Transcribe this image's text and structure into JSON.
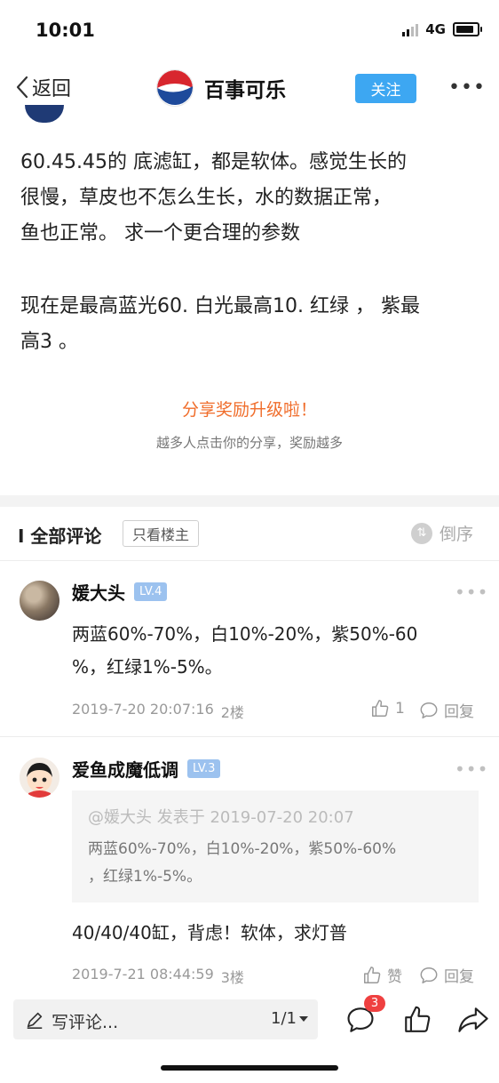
{
  "status_bar": {
    "time": "10:01",
    "network": "4G"
  },
  "nav": {
    "back_label": "返回",
    "title": "百事可乐",
    "follow_label": "关注",
    "more": "•••"
  },
  "post": {
    "paragraph1_lines": [
      "60.45.45的 底滤缸，都是软体。感觉生长的",
      "很慢，草皮也不怎么生长，水的数据正常，",
      "鱼也正常。 求一个更合理的参数"
    ],
    "paragraph2_lines": [
      "现在是最高蓝光60. 白光最高10.  红绿 ，  紫最",
      "高3 。"
    ]
  },
  "share": {
    "title": "分享奖励升级啦！",
    "subtitle": "越多人点击你的分享，奖励越多"
  },
  "comments_header": {
    "title": "I 全部评论",
    "owner_only": "只看楼主",
    "sort": "倒序"
  },
  "comments": [
    {
      "username": "媛大头",
      "level": "LV.4",
      "lines": [
        "两蓝60%-70%，白10%-20%，紫50%-60",
        "%，红绿1%-5%。"
      ],
      "timestamp": "2019-7-20 20:07:16",
      "floor": "2楼",
      "like_count": "1",
      "reply_label": "回复",
      "more": "•••"
    },
    {
      "username": "爱鱼成魔低调",
      "level": "LV.3",
      "quote_header": "@媛大头 发表于 2019-07-20 20:07",
      "quote_lines": [
        "两蓝60%-70%，白10%-20%，紫50%-60%",
        "，红绿1%-5%。"
      ],
      "text": "40/40/40缸，背虑！软体，求灯普",
      "timestamp": "2019-7-21 08:44:59",
      "floor": "3楼",
      "like_label": "赞",
      "reply_label": "回复",
      "more": "•••"
    }
  ],
  "bottom_bar": {
    "compose_placeholder": "写评论...",
    "page_indicator": "1/1",
    "comment_badge": "3"
  },
  "colors": {
    "accent_blue": "#3da7f2",
    "share_orange": "#f06d2b",
    "level_badge": "#9cc2ef",
    "badge_red": "#ef4040"
  }
}
